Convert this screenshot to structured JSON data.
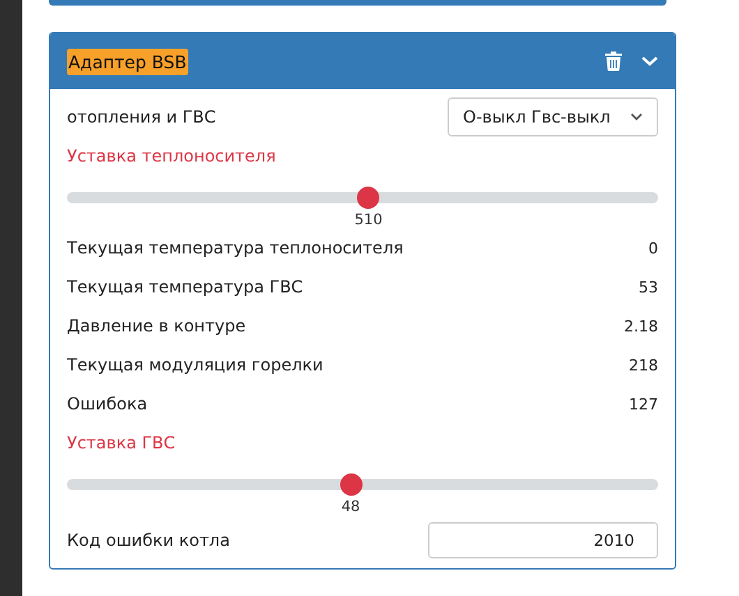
{
  "card": {
    "title": "Адаптер BSB",
    "title_highlighted": true,
    "expanded": true
  },
  "items": [
    {
      "kind": "select",
      "label": "отопления и ГВС",
      "value": "О-выкл Гвс-выкл"
    },
    {
      "kind": "slider",
      "label": "Уставка теплоносителя",
      "level": 0.51,
      "reading": "510"
    },
    {
      "kind": "value",
      "label": "Текущая температура теплоносителя",
      "value": "0"
    },
    {
      "kind": "value",
      "label": "Текущая температура ГВС",
      "value": "53"
    },
    {
      "kind": "value",
      "label": "Давление в контуре",
      "value": "2.18"
    },
    {
      "kind": "value",
      "label": "Текущая модуляция горелки",
      "value": "218"
    },
    {
      "kind": "value",
      "label": "Ошибока",
      "value": "127"
    },
    {
      "kind": "slider",
      "label": "Уставка ГВС",
      "level": 0.48,
      "reading": "48"
    },
    {
      "kind": "input",
      "label": "Код ошибки котла",
      "value": "2010"
    }
  ]
}
